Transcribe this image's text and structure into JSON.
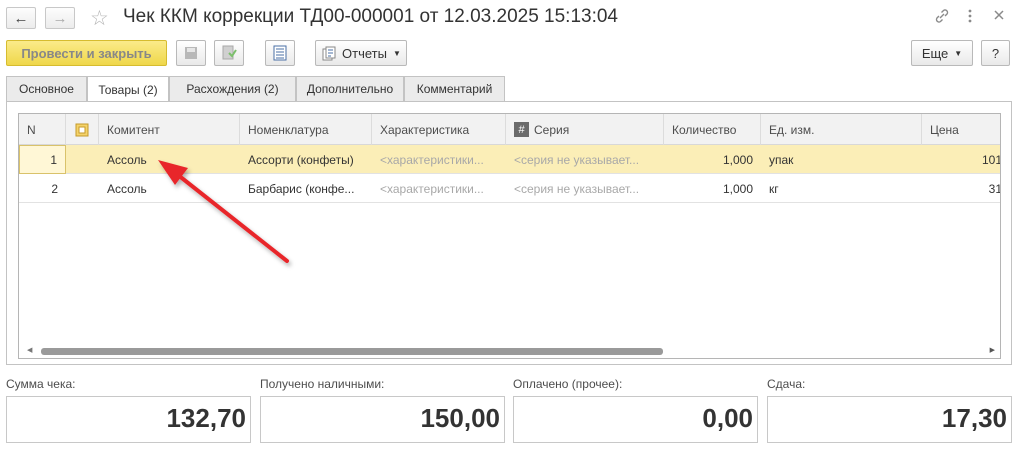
{
  "window": {
    "title": "Чек ККМ коррекции ТД00-000001 от 12.03.2025 15:13:04",
    "back_icon": "arrow-left",
    "forward_icon": "arrow-right",
    "favorite_icon": "star",
    "link_icon": "link",
    "more_icon": "vertical-dots",
    "close_icon": "close"
  },
  "toolbar": {
    "post_close_label": "Провести и закрыть",
    "reports_label": "Отчеты",
    "more_label": "Еще",
    "help_label": "?"
  },
  "tabs": [
    {
      "label": "Основное"
    },
    {
      "label": "Товары (2)"
    },
    {
      "label": "Расхождения (2)"
    },
    {
      "label": "Дополнительно"
    },
    {
      "label": "Комментарий"
    }
  ],
  "table": {
    "columns": {
      "n": "N",
      "committent": "Комитент",
      "nomenclature": "Номенклатура",
      "characteristic": "Характеристика",
      "series": "Серия",
      "quantity": "Количество",
      "unit": "Ед. изм.",
      "price": "Цена"
    },
    "rows": [
      {
        "n": "1",
        "committent": "Ассоль",
        "nomenclature": "Ассорти (конфеты)",
        "characteristic": "<характеристики...",
        "series": "<серия не указывает...",
        "quantity": "1,000",
        "unit": "упак",
        "price": "101"
      },
      {
        "n": "2",
        "committent": "Ассоль",
        "nomenclature": "Барбарис (конфе...",
        "characteristic": "<характеристики...",
        "series": "<серия не указывает...",
        "quantity": "1,000",
        "unit": "кг",
        "price": "31"
      }
    ]
  },
  "totals": {
    "check_sum_label": "Сумма чека:",
    "check_sum_value": "132,70",
    "cash_label": "Получено наличными:",
    "cash_value": "150,00",
    "other_label": "Оплачено (прочее):",
    "other_value": "0,00",
    "change_label": "Сдача:",
    "change_value": "17,30"
  },
  "colors": {
    "accent_yellow": "#f4dc5c",
    "selected_row": "#fbeeb7",
    "annotation_arrow": "#e8282b"
  }
}
